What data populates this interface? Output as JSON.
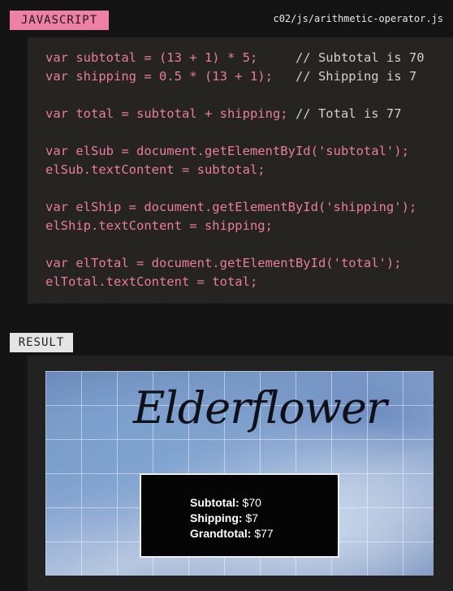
{
  "header": {
    "language_label": "JAVASCRIPT",
    "file_path": "c02/js/arithmetic-operator.js"
  },
  "code": {
    "lines": [
      {
        "code": "var subtotal = (13 + 1) * 5;     ",
        "comment": "// Subtotal is 70"
      },
      {
        "code": "var shipping = 0.5 * (13 + 1);   ",
        "comment": "// Shipping is 7"
      },
      {
        "code": "",
        "comment": ""
      },
      {
        "code": "var total = subtotal + shipping; ",
        "comment": "// Total is 77"
      },
      {
        "code": "",
        "comment": ""
      },
      {
        "code": "var elSub = document.getElementById('subtotal');",
        "comment": ""
      },
      {
        "code": "elSub.textContent = subtotal;",
        "comment": ""
      },
      {
        "code": "",
        "comment": ""
      },
      {
        "code": "var elShip = document.getElementById('shipping');",
        "comment": ""
      },
      {
        "code": "elShip.textContent = shipping;",
        "comment": ""
      },
      {
        "code": "",
        "comment": ""
      },
      {
        "code": "var elTotal = document.getElementById('total');",
        "comment": ""
      },
      {
        "code": "elTotal.textContent = total;",
        "comment": ""
      }
    ]
  },
  "result": {
    "label": "RESULT",
    "logo_text": "Elderflower",
    "totals": [
      {
        "label": "Subtotal:",
        "value": "$70"
      },
      {
        "label": "Shipping:",
        "value": "$7"
      },
      {
        "label": "Grandtotal:",
        "value": "$77"
      }
    ]
  },
  "colors": {
    "js_label_bg": "#ee7fa5",
    "code_text": "#e87d9d",
    "comment_text": "#cfcfcf",
    "result_label_bg": "#e4e4e4"
  }
}
